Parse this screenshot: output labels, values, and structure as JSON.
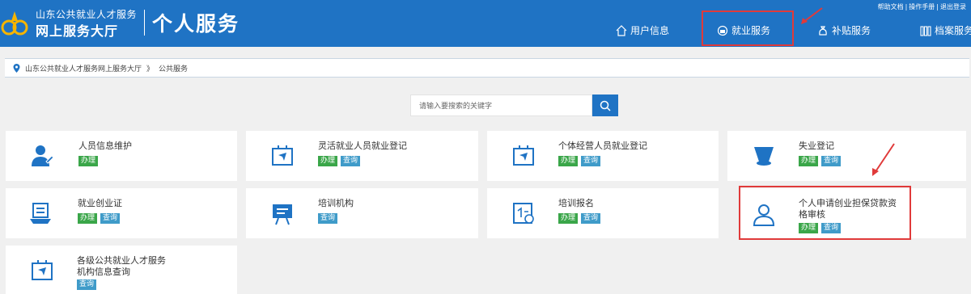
{
  "header": {
    "logo_line1": "山东公共就业人才服务",
    "logo_line2": "网上服务大厅",
    "title": "个人服务",
    "top_links": [
      "帮助文档",
      "操作手册",
      "退出登录"
    ],
    "nav": [
      {
        "label": "用户信息",
        "icon": "home-icon"
      },
      {
        "label": "就业服务",
        "icon": "briefcase-icon"
      },
      {
        "label": "补贴服务",
        "icon": "moneybag-icon"
      },
      {
        "label": "档案服务",
        "icon": "archive-icon"
      }
    ]
  },
  "breadcrumb": {
    "home": "山东公共就业人才服务网上服务大厅",
    "separator": "》",
    "current": "公共服务"
  },
  "search": {
    "placeholder": "请输入要搜索的关键字"
  },
  "services": [
    {
      "title": "人员信息维护",
      "badges": [
        "办理"
      ],
      "icon": "person-edit-icon"
    },
    {
      "title": "灵活就业人员就业登记",
      "badges": [
        "办理",
        "查询"
      ],
      "icon": "flag-board-icon"
    },
    {
      "title": "个体经营人员就业登记",
      "badges": [
        "办理",
        "查询"
      ],
      "icon": "flag-board-icon"
    },
    {
      "title": "失业登记",
      "badges": [
        "办理",
        "查询"
      ],
      "icon": "bucket-icon"
    },
    {
      "title": "就业创业证",
      "badges": [
        "办理",
        "查询"
      ],
      "icon": "certificate-icon"
    },
    {
      "title": "培训机构",
      "badges": [
        "查询"
      ],
      "icon": "easel-icon"
    },
    {
      "title": "培训报名",
      "badges": [
        "办理",
        "查询"
      ],
      "icon": "document-icon"
    },
    {
      "title": "个人申请创业担保贷款资格审核",
      "badges": [
        "办理",
        "查询"
      ],
      "icon": "user-outline-icon"
    },
    {
      "title": "各级公共就业人才服务机构信息查询",
      "badges": [
        "查询"
      ],
      "icon": "flag-board-icon"
    }
  ],
  "colors": {
    "header_bg": "#1f73c4",
    "badge_green": "#3aa649",
    "badge_blue": "#3f9bc9",
    "highlight": "#e03a3a"
  }
}
